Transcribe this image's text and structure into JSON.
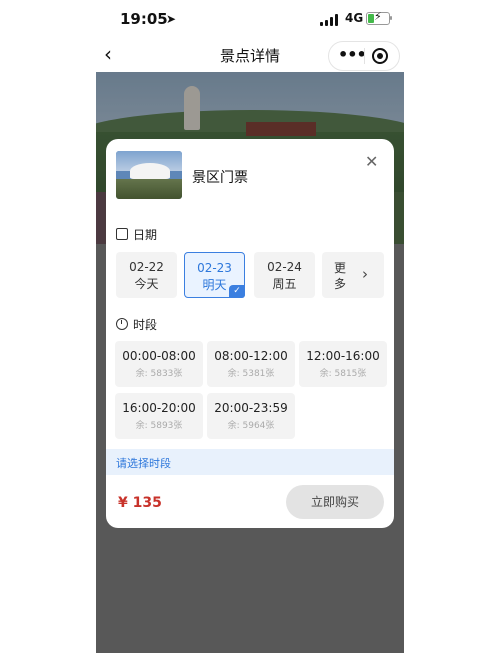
{
  "status_bar": {
    "time": "19:05",
    "network": "4G"
  },
  "nav": {
    "back": "‹",
    "title": "景点详情",
    "more": "•••"
  },
  "product": {
    "name": "景区门票",
    "image_icon": "mountain-photo",
    "close": "✕"
  },
  "date_section": {
    "title": "日期",
    "dates": [
      {
        "date": "02-22",
        "label": "今天",
        "selected": false
      },
      {
        "date": "02-23",
        "label": "明天",
        "selected": true
      },
      {
        "date": "02-24",
        "label": "周五",
        "selected": false
      }
    ],
    "more_line1": "更",
    "more_line2": "多",
    "more_chevron": "›",
    "check_mark": "✓"
  },
  "time_section": {
    "title": "时段",
    "slots": [
      {
        "time": "00:00-08:00",
        "remain": "余: 5833张"
      },
      {
        "time": "08:00-12:00",
        "remain": "余: 5381张"
      },
      {
        "time": "12:00-16:00",
        "remain": "余: 5815张"
      },
      {
        "time": "16:00-20:00",
        "remain": "余: 5893张"
      },
      {
        "time": "20:00-23:59",
        "remain": "余: 5964张"
      }
    ]
  },
  "hint": "请选择时段",
  "footer": {
    "price": "¥ 135",
    "buy_label": "立即购买"
  },
  "colors": {
    "accent": "#3b7fe0",
    "price": "#c8322a",
    "hint_bg": "#e8f1fc"
  }
}
